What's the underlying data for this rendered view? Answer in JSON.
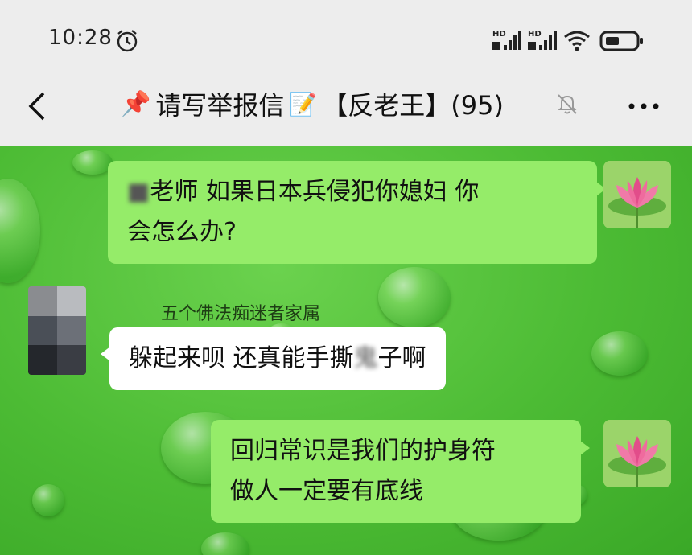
{
  "status": {
    "time": "10:28",
    "sig1": "HD",
    "sig2": "HD"
  },
  "header": {
    "title_main": "请写举报信",
    "title_group": "【反老王】(95)",
    "pin_icon": "📌",
    "memo_icon": "📝"
  },
  "messages": [
    {
      "side": "me",
      "line1_pre": "老师 如果日本兵侵犯你媳妇 你",
      "line2": "会怎么办?"
    },
    {
      "side": "other",
      "sender": "五个佛法痴迷者家属",
      "text_pre": "躲起来呗  还真能手撕",
      "text_hidden": "鬼",
      "text_post": "子啊"
    },
    {
      "side": "me",
      "line1": "回归常识是我们的护身符",
      "line2": "做人一定要有底线"
    }
  ],
  "colors": {
    "my_bubble": "#95ec69",
    "other_bubble": "#ffffff",
    "chat_bg": "#4cbb34"
  }
}
